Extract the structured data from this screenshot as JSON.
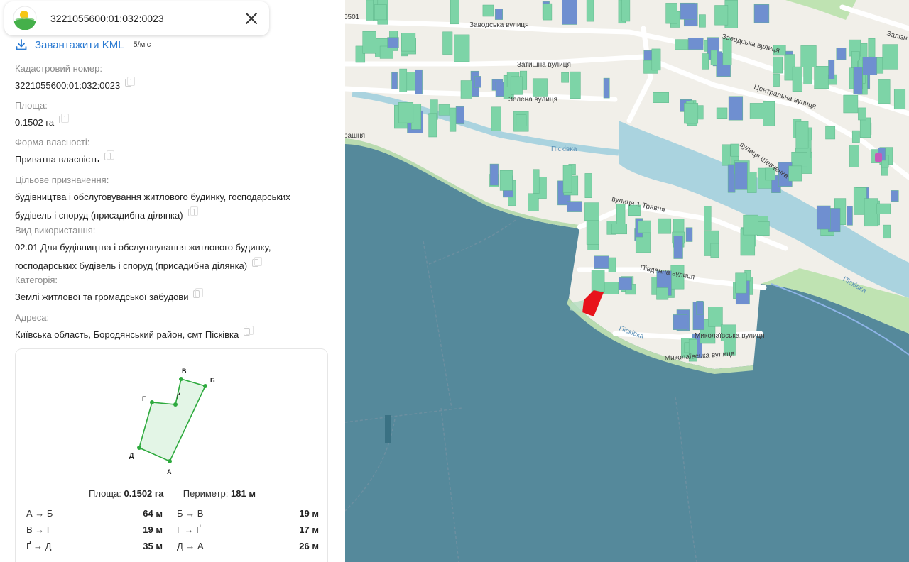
{
  "header": {
    "title": "3221055600:01:032:0023",
    "logo_icon": "sun-field-logo-icon",
    "close_icon": "close-icon"
  },
  "kml": {
    "link_label": "Завантажити KML",
    "price": "5/міс",
    "icon": "download-icon"
  },
  "fields": {
    "cadastral": {
      "label": "Кадастровий номер:",
      "value": "3221055600:01:032:0023"
    },
    "area": {
      "label": "Площа:",
      "value": "0.1502 га"
    },
    "ownership": {
      "label": "Форма власності:",
      "value": "Приватна власність"
    },
    "purpose": {
      "label": "Цільове призначення:",
      "value": "будівництва і обслуговування житлового будинку, господарських будівель і споруд (присадибна ділянка)"
    },
    "usage": {
      "label": "Вид використання:",
      "value": "02.01 Для будівництва і обслуговування житлового будинку, господарських будівель і споруд (присадибна ділянка)"
    },
    "category": {
      "label": "Категорія:",
      "value": "Землі житлової та громадської забудови"
    },
    "address": {
      "label": "Адреса:",
      "value": "Київська область, Бородянський район, смт Пісківка"
    }
  },
  "plot": {
    "vertices": [
      "В",
      "Б",
      "Г",
      "Ґ",
      "Д",
      "А"
    ],
    "area_label": "Площа:",
    "area_value": "0.1502 га",
    "perimeter_label": "Периметр:",
    "perimeter_value": "181 м",
    "segments": [
      {
        "name": "А → Б",
        "length": "64 м"
      },
      {
        "name": "Б → В",
        "length": "19 м"
      },
      {
        "name": "В → Г",
        "length": "19 м"
      },
      {
        "name": "Г → Ґ",
        "length": "17 м"
      },
      {
        "name": "Ґ → Д",
        "length": "35 м"
      },
      {
        "name": "Д → А",
        "length": "26 м"
      }
    ],
    "colors": {
      "stroke": "#2eaa3e",
      "fill": "#e3f5e6"
    }
  },
  "map": {
    "labels": {
      "zavodska1": "Заводська вулиця",
      "zavodska2": "Заводська вулиця",
      "zatyshna": "Затишна вулиця",
      "zelena": "Зелена вулиця",
      "tsentralna": "Центральна вулиця",
      "shevchenka": "вулиця Шевченка",
      "traвня": "вулиця 1 Травня",
      "pivdenna": "Південна вулиця",
      "mykolaivska1": "Миколаївська вулиця",
      "mykolaivska2": "Миколаївська вулиця",
      "piskivka_river1": "Пісківка",
      "piskivka_river2": "Пісківка",
      "piskivka_town": "Пісківка",
      "zalizn": "Залізн",
      "code": "0501",
      "rasnia": "рашня"
    },
    "colors": {
      "water": "#55899b",
      "river": "#aad3df",
      "building": "#7dd4a7",
      "building_blue": "#6f8fd0",
      "selected": "#e8131b",
      "land": "#f1efe9",
      "park": "#bfe3b2"
    }
  }
}
